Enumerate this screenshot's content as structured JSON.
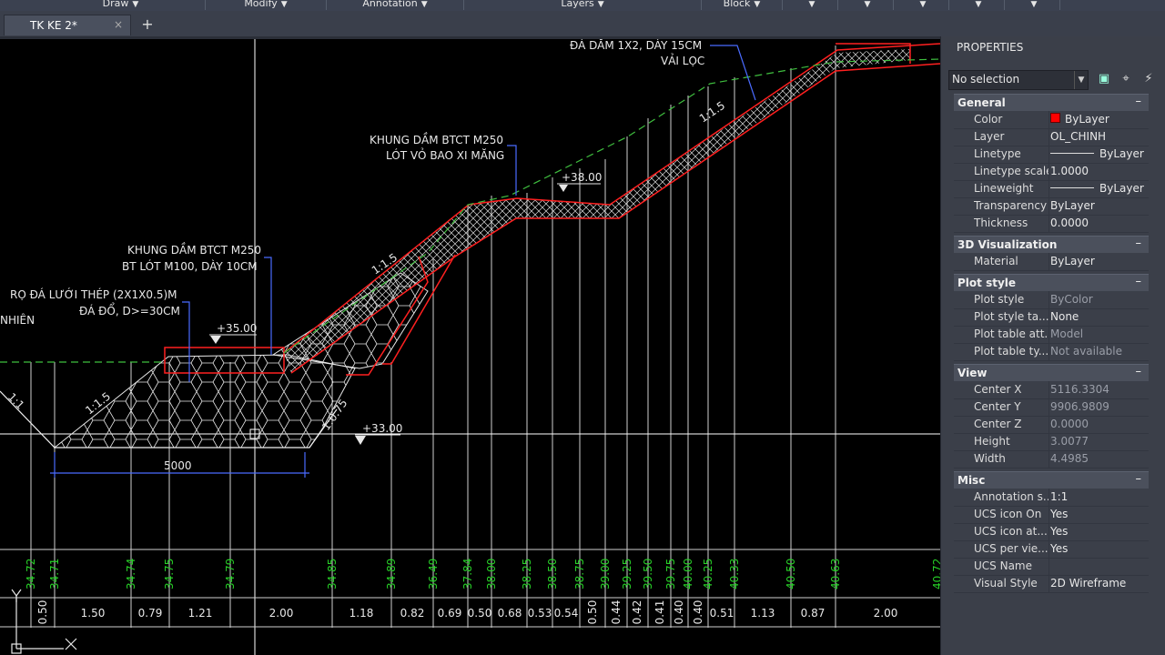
{
  "ribbon": {
    "panels": [
      "Draw",
      "Modify",
      "Annotation",
      "Layers",
      "Block"
    ]
  },
  "tabs": {
    "document": "TK KE 2*",
    "close_glyph": "×",
    "new_glyph": "+"
  },
  "drawing": {
    "annotations": {
      "da_dam": "ĐÁ DĂM 1X2, DÀY 15CM",
      "vai_loc": "VẢI LỌC",
      "khung_dam_1": "KHUNG DẦM BTCT M250",
      "lot_vo_bao": "LÓT VỎ BAO XI MĂNG",
      "khung_dam_2": "KHUNG DẦM BTCT M250",
      "bt_lot": "BT LÓT M100, DÀY 10CM",
      "ro_da": "RỌ ĐÁ LƯỚI THÉP (2X1X0.5)M",
      "da_do": "ĐÁ ĐỔ, D>=30CM",
      "nhien": "NHIÊN"
    },
    "elevations": [
      "+38.00",
      "+35.00",
      "+33.00"
    ],
    "slopes": [
      "1:1.5",
      "1:1.5",
      "1:1.5",
      "1:1",
      "1:0.75"
    ],
    "dimension": "5000",
    "station_elevations": [
      "34.72",
      "34.71",
      "34.74",
      "34.75",
      "34.79",
      "34.85",
      "34.89",
      "36.49",
      "37.84",
      "38.00",
      "38.25",
      "38.50",
      "38.75",
      "39.00",
      "39.25",
      "39.50",
      "39.75",
      "40.00",
      "40.25",
      "40.33",
      "40.50",
      "40.63",
      "40.72"
    ],
    "distances": [
      "0.50",
      "1.50",
      "0.79",
      "1.21",
      "2.00",
      "1.18",
      "0.82",
      "0.69",
      "0.50",
      "0.68",
      "0.53",
      "0.54",
      "0.50",
      "0.44",
      "0.42",
      "0.41",
      "0.40",
      "0.40",
      "0.51",
      "1.13",
      "0.87",
      "2.00"
    ]
  },
  "properties": {
    "title": "PROPERTIES",
    "selection": "No selection",
    "sections": [
      {
        "name": "General",
        "rows": [
          {
            "key": "Color",
            "value": "ByLayer"
          },
          {
            "key": "Layer",
            "value": "OL_CHINH"
          },
          {
            "key": "Linetype",
            "value": "ByLayer"
          },
          {
            "key": "Linetype scale",
            "value": "1.0000"
          },
          {
            "key": "Lineweight",
            "value": "ByLayer"
          },
          {
            "key": "Transparency",
            "value": "ByLayer"
          },
          {
            "key": "Thickness",
            "value": "0.0000"
          }
        ]
      },
      {
        "name": "3D Visualization",
        "rows": [
          {
            "key": "Material",
            "value": "ByLayer"
          }
        ]
      },
      {
        "name": "Plot style",
        "rows": [
          {
            "key": "Plot style",
            "value": "ByColor"
          },
          {
            "key": "Plot style ta...",
            "value": "None"
          },
          {
            "key": "Plot table att...",
            "value": "Model"
          },
          {
            "key": "Plot table ty...",
            "value": "Not available"
          }
        ]
      },
      {
        "name": "View",
        "rows": [
          {
            "key": "Center X",
            "value": "5116.3304"
          },
          {
            "key": "Center Y",
            "value": "9906.9809"
          },
          {
            "key": "Center Z",
            "value": "0.0000"
          },
          {
            "key": "Height",
            "value": "3.0077"
          },
          {
            "key": "Width",
            "value": "4.4985"
          }
        ]
      },
      {
        "name": "Misc",
        "rows": [
          {
            "key": "Annotation s...",
            "value": "1:1"
          },
          {
            "key": "UCS icon On",
            "value": "Yes"
          },
          {
            "key": "UCS icon at...",
            "value": "Yes"
          },
          {
            "key": "UCS per vie...",
            "value": "Yes"
          },
          {
            "key": "UCS Name",
            "value": ""
          },
          {
            "key": "Visual Style",
            "value": "2D Wireframe"
          }
        ]
      }
    ],
    "colors": {
      "accent_red": "#ff0000",
      "panel": "#3b3f49"
    }
  }
}
